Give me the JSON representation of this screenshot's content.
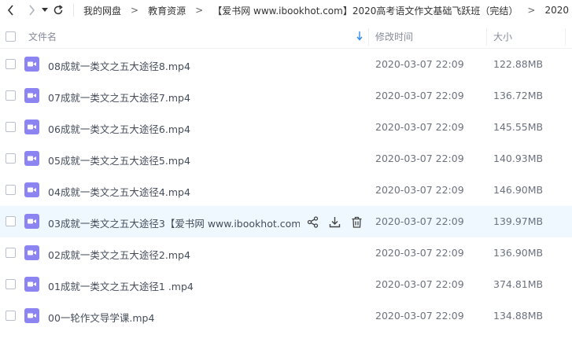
{
  "breadcrumb": {
    "items": [
      "我的网盘",
      "教育资源",
      "【爱书网 www.ibookhot.com】2020高考语文作文基础飞跃班（完结）",
      "2020"
    ],
    "separator": ">"
  },
  "header": {
    "name": "文件名",
    "time": "修改时间",
    "size": "大小"
  },
  "files": [
    {
      "name": "08成就一类文之五大途径8.mp4",
      "time": "2020-03-07 22:09",
      "size": "122.88MB"
    },
    {
      "name": "07成就一类文之五大途径7.mp4",
      "time": "2020-03-07 22:09",
      "size": "136.72MB"
    },
    {
      "name": "06成就一类文之五大途径6.mp4",
      "time": "2020-03-07 22:09",
      "size": "145.55MB"
    },
    {
      "name": "05成就一类文之五大途径5.mp4",
      "time": "2020-03-07 22:09",
      "size": "140.93MB"
    },
    {
      "name": "04成就一类文之五大途径4.mp4",
      "time": "2020-03-07 22:09",
      "size": "146.90MB"
    },
    {
      "name": "03成就一类文之五大途径3【爱书网 www.ibookhot.com...",
      "time": "2020-03-07 22:09",
      "size": "139.97MB"
    },
    {
      "name": "02成就一类文之五大途径2.mp4",
      "time": "2020-03-07 22:09",
      "size": "136.90MB"
    },
    {
      "name": "01成就一类文之五大途径1 .mp4",
      "time": "2020-03-07 22:09",
      "size": "374.81MB"
    },
    {
      "name": "00一轮作文导学课.mp4",
      "time": "2020-03-07 22:09",
      "size": "134.88MB"
    }
  ],
  "colors": {
    "video_icon": "#8c84f0",
    "hover_row": "#eef8fe",
    "sort_arrow": "#2e8ee8"
  },
  "icons": {
    "back": "chevron-left-icon",
    "forward": "chevron-right-icon",
    "dropdown": "caret-down-icon",
    "refresh": "refresh-icon",
    "sort": "sort-arrow-down-icon",
    "file": "video-file-icon",
    "share": "share-icon",
    "download": "download-icon",
    "delete": "trash-icon"
  }
}
